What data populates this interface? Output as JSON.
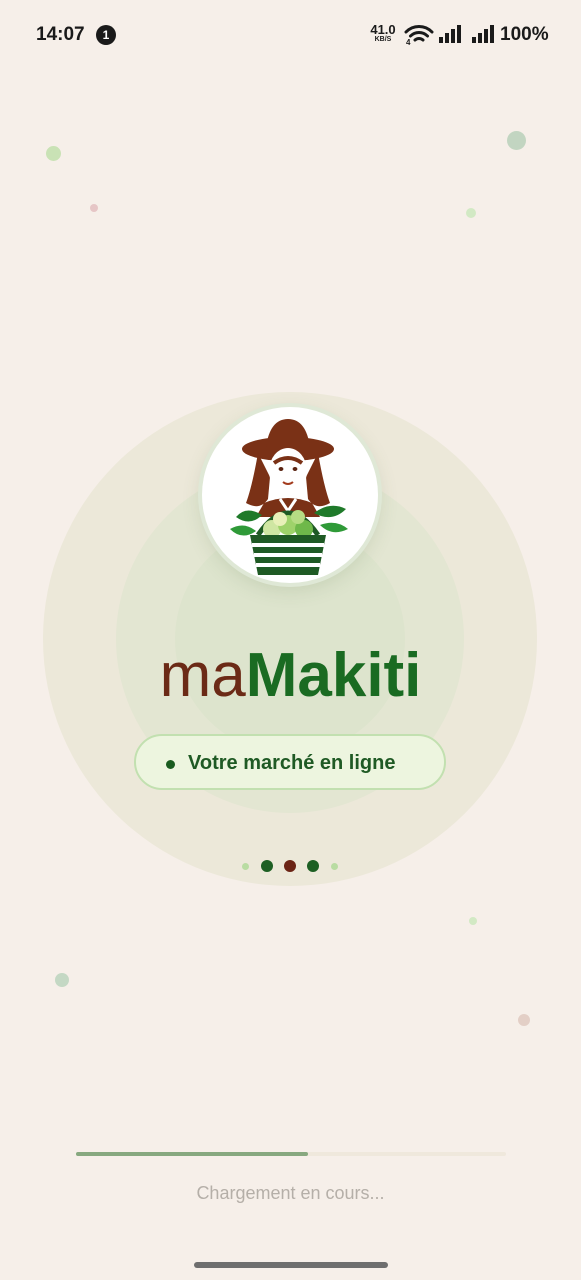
{
  "status_bar": {
    "time": "14:07",
    "notification_count": "1",
    "net_speed_value": "41.0",
    "net_speed_unit": "KB/S",
    "wifi_label": "4",
    "battery": "100%"
  },
  "splash": {
    "brand_prefix": "ma",
    "brand_name": "Makiti",
    "tagline": "Votre marché en ligne",
    "loading_text": "Chargement en cours...",
    "progress_percent": 54
  },
  "colors": {
    "background": "#f6efe9",
    "brand_prefix": "#6b2a16",
    "brand_name": "#1a6b22",
    "progress_fill": "#87a87f"
  }
}
